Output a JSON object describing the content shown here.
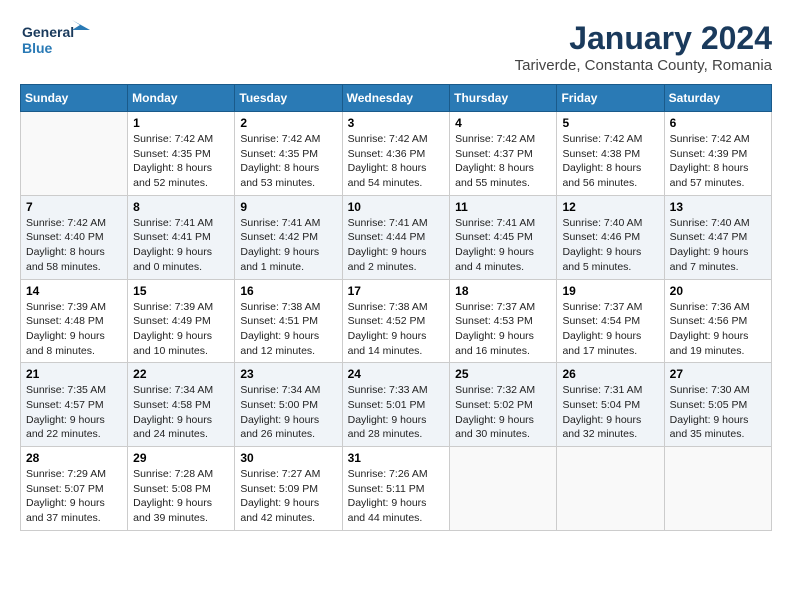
{
  "logo": {
    "line1": "General",
    "line2": "Blue"
  },
  "title": "January 2024",
  "subtitle": "Tariverde, Constanta County, Romania",
  "weekdays": [
    "Sunday",
    "Monday",
    "Tuesday",
    "Wednesday",
    "Thursday",
    "Friday",
    "Saturday"
  ],
  "weeks": [
    [
      {
        "day": "",
        "sunrise": "",
        "sunset": "",
        "daylight": ""
      },
      {
        "day": "1",
        "sunrise": "Sunrise: 7:42 AM",
        "sunset": "Sunset: 4:35 PM",
        "daylight": "Daylight: 8 hours and 52 minutes."
      },
      {
        "day": "2",
        "sunrise": "Sunrise: 7:42 AM",
        "sunset": "Sunset: 4:35 PM",
        "daylight": "Daylight: 8 hours and 53 minutes."
      },
      {
        "day": "3",
        "sunrise": "Sunrise: 7:42 AM",
        "sunset": "Sunset: 4:36 PM",
        "daylight": "Daylight: 8 hours and 54 minutes."
      },
      {
        "day": "4",
        "sunrise": "Sunrise: 7:42 AM",
        "sunset": "Sunset: 4:37 PM",
        "daylight": "Daylight: 8 hours and 55 minutes."
      },
      {
        "day": "5",
        "sunrise": "Sunrise: 7:42 AM",
        "sunset": "Sunset: 4:38 PM",
        "daylight": "Daylight: 8 hours and 56 minutes."
      },
      {
        "day": "6",
        "sunrise": "Sunrise: 7:42 AM",
        "sunset": "Sunset: 4:39 PM",
        "daylight": "Daylight: 8 hours and 57 minutes."
      }
    ],
    [
      {
        "day": "7",
        "sunrise": "Sunrise: 7:42 AM",
        "sunset": "Sunset: 4:40 PM",
        "daylight": "Daylight: 8 hours and 58 minutes."
      },
      {
        "day": "8",
        "sunrise": "Sunrise: 7:41 AM",
        "sunset": "Sunset: 4:41 PM",
        "daylight": "Daylight: 9 hours and 0 minutes."
      },
      {
        "day": "9",
        "sunrise": "Sunrise: 7:41 AM",
        "sunset": "Sunset: 4:42 PM",
        "daylight": "Daylight: 9 hours and 1 minute."
      },
      {
        "day": "10",
        "sunrise": "Sunrise: 7:41 AM",
        "sunset": "Sunset: 4:44 PM",
        "daylight": "Daylight: 9 hours and 2 minutes."
      },
      {
        "day": "11",
        "sunrise": "Sunrise: 7:41 AM",
        "sunset": "Sunset: 4:45 PM",
        "daylight": "Daylight: 9 hours and 4 minutes."
      },
      {
        "day": "12",
        "sunrise": "Sunrise: 7:40 AM",
        "sunset": "Sunset: 4:46 PM",
        "daylight": "Daylight: 9 hours and 5 minutes."
      },
      {
        "day": "13",
        "sunrise": "Sunrise: 7:40 AM",
        "sunset": "Sunset: 4:47 PM",
        "daylight": "Daylight: 9 hours and 7 minutes."
      }
    ],
    [
      {
        "day": "14",
        "sunrise": "Sunrise: 7:39 AM",
        "sunset": "Sunset: 4:48 PM",
        "daylight": "Daylight: 9 hours and 8 minutes."
      },
      {
        "day": "15",
        "sunrise": "Sunrise: 7:39 AM",
        "sunset": "Sunset: 4:49 PM",
        "daylight": "Daylight: 9 hours and 10 minutes."
      },
      {
        "day": "16",
        "sunrise": "Sunrise: 7:38 AM",
        "sunset": "Sunset: 4:51 PM",
        "daylight": "Daylight: 9 hours and 12 minutes."
      },
      {
        "day": "17",
        "sunrise": "Sunrise: 7:38 AM",
        "sunset": "Sunset: 4:52 PM",
        "daylight": "Daylight: 9 hours and 14 minutes."
      },
      {
        "day": "18",
        "sunrise": "Sunrise: 7:37 AM",
        "sunset": "Sunset: 4:53 PM",
        "daylight": "Daylight: 9 hours and 16 minutes."
      },
      {
        "day": "19",
        "sunrise": "Sunrise: 7:37 AM",
        "sunset": "Sunset: 4:54 PM",
        "daylight": "Daylight: 9 hours and 17 minutes."
      },
      {
        "day": "20",
        "sunrise": "Sunrise: 7:36 AM",
        "sunset": "Sunset: 4:56 PM",
        "daylight": "Daylight: 9 hours and 19 minutes."
      }
    ],
    [
      {
        "day": "21",
        "sunrise": "Sunrise: 7:35 AM",
        "sunset": "Sunset: 4:57 PM",
        "daylight": "Daylight: 9 hours and 22 minutes."
      },
      {
        "day": "22",
        "sunrise": "Sunrise: 7:34 AM",
        "sunset": "Sunset: 4:58 PM",
        "daylight": "Daylight: 9 hours and 24 minutes."
      },
      {
        "day": "23",
        "sunrise": "Sunrise: 7:34 AM",
        "sunset": "Sunset: 5:00 PM",
        "daylight": "Daylight: 9 hours and 26 minutes."
      },
      {
        "day": "24",
        "sunrise": "Sunrise: 7:33 AM",
        "sunset": "Sunset: 5:01 PM",
        "daylight": "Daylight: 9 hours and 28 minutes."
      },
      {
        "day": "25",
        "sunrise": "Sunrise: 7:32 AM",
        "sunset": "Sunset: 5:02 PM",
        "daylight": "Daylight: 9 hours and 30 minutes."
      },
      {
        "day": "26",
        "sunrise": "Sunrise: 7:31 AM",
        "sunset": "Sunset: 5:04 PM",
        "daylight": "Daylight: 9 hours and 32 minutes."
      },
      {
        "day": "27",
        "sunrise": "Sunrise: 7:30 AM",
        "sunset": "Sunset: 5:05 PM",
        "daylight": "Daylight: 9 hours and 35 minutes."
      }
    ],
    [
      {
        "day": "28",
        "sunrise": "Sunrise: 7:29 AM",
        "sunset": "Sunset: 5:07 PM",
        "daylight": "Daylight: 9 hours and 37 minutes."
      },
      {
        "day": "29",
        "sunrise": "Sunrise: 7:28 AM",
        "sunset": "Sunset: 5:08 PM",
        "daylight": "Daylight: 9 hours and 39 minutes."
      },
      {
        "day": "30",
        "sunrise": "Sunrise: 7:27 AM",
        "sunset": "Sunset: 5:09 PM",
        "daylight": "Daylight: 9 hours and 42 minutes."
      },
      {
        "day": "31",
        "sunrise": "Sunrise: 7:26 AM",
        "sunset": "Sunset: 5:11 PM",
        "daylight": "Daylight: 9 hours and 44 minutes."
      },
      {
        "day": "",
        "sunrise": "",
        "sunset": "",
        "daylight": ""
      },
      {
        "day": "",
        "sunrise": "",
        "sunset": "",
        "daylight": ""
      },
      {
        "day": "",
        "sunrise": "",
        "sunset": "",
        "daylight": ""
      }
    ]
  ]
}
